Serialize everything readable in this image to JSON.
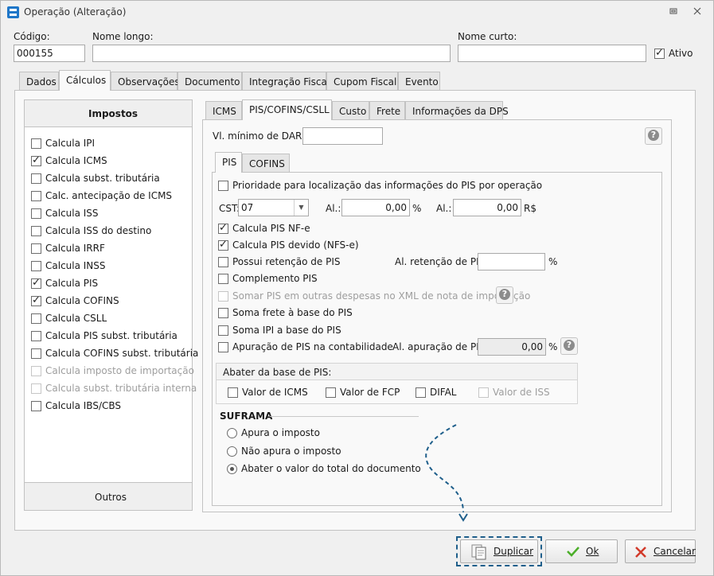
{
  "window": {
    "title": "Operação (Alteração)"
  },
  "header": {
    "codigo_label": "Código:",
    "codigo_value": "000155",
    "nome_longo_label": "Nome longo:",
    "nome_longo_value": "",
    "nome_curto_label": "Nome curto:",
    "nome_curto_value": "",
    "ativo_label": "Ativo",
    "ativo_checked": true
  },
  "main_tabs": [
    "Dados",
    "Cálculos",
    "Observações",
    "Documento",
    "Integração Fiscal",
    "Cupom Fiscal",
    "Evento"
  ],
  "main_tab_active": "Cálculos",
  "impostos": {
    "title": "Impostos",
    "items": [
      {
        "label": "Calcula IPI",
        "checked": false,
        "enabled": true
      },
      {
        "label": "Calcula ICMS",
        "checked": true,
        "enabled": true
      },
      {
        "label": "Calcula subst. tributária",
        "checked": false,
        "enabled": true
      },
      {
        "label": "Calc. antecipação de ICMS",
        "checked": false,
        "enabled": true
      },
      {
        "label": "Calcula ISS",
        "checked": false,
        "enabled": true
      },
      {
        "label": "Calcula ISS do destino",
        "checked": false,
        "enabled": true
      },
      {
        "label": "Calcula IRRF",
        "checked": false,
        "enabled": true
      },
      {
        "label": "Calcula INSS",
        "checked": false,
        "enabled": true
      },
      {
        "label": "Calcula PIS",
        "checked": true,
        "enabled": true
      },
      {
        "label": "Calcula COFINS",
        "checked": true,
        "enabled": true
      },
      {
        "label": "Calcula CSLL",
        "checked": false,
        "enabled": true
      },
      {
        "label": "Calcula PIS subst. tributária",
        "checked": false,
        "enabled": true
      },
      {
        "label": "Calcula COFINS subst. tributária",
        "checked": false,
        "enabled": true
      },
      {
        "label": "Calcula imposto de importação",
        "checked": false,
        "enabled": false
      },
      {
        "label": "Calcula subst. tributária interna",
        "checked": false,
        "enabled": false
      },
      {
        "label": "Calcula IBS/CBS",
        "checked": false,
        "enabled": true
      }
    ],
    "outros_label": "Outros"
  },
  "sub_tabs": [
    "ICMS",
    "PIS/COFINS/CSLL",
    "Custo",
    "Frete",
    "Informações da DPS"
  ],
  "sub_tab_active": "PIS/COFINS/CSLL",
  "darf": {
    "label": "Vl. mínimo de DARF:",
    "value": ""
  },
  "pis_tabs": [
    "PIS",
    "COFINS"
  ],
  "pis_tab_active": "PIS",
  "pis": {
    "prioridade_label": "Prioridade para localização das informações do PIS por operação",
    "cst_label": "CST:",
    "cst_value": "07",
    "al1_label": "Al.:",
    "al1_value": "0,00",
    "al1_unit": "%",
    "al2_label": "Al.:",
    "al2_value": "0,00",
    "al2_unit": "R$",
    "calcula_nfe_label": "Calcula PIS NF-e",
    "calcula_devido_label": "Calcula PIS devido (NFS-e)",
    "retencao_label": "Possui retenção de PIS",
    "al_retencao_label": "Al. retenção de PIS:",
    "al_retencao_value": "",
    "al_retencao_unit": "%",
    "complemento_label": "Complemento PIS",
    "somar_label": "Somar PIS em outras despesas no XML de nota de importação",
    "soma_frete_label": "Soma frete à base do PIS",
    "soma_ipi_label": "Soma IPI a base do PIS",
    "apuracao_label": "Apuração de PIS na contabilidade",
    "al_apuracao_label": "Al. apuração de PIS:",
    "al_apuracao_value": "0,00",
    "al_apuracao_unit": "%",
    "abater_title": "Abater da base de PIS:",
    "abater_icms": "Valor de ICMS",
    "abater_fcp": "Valor de FCP",
    "abater_difal": "DIFAL",
    "abater_iss": "Valor de ISS"
  },
  "suframa": {
    "title": "SUFRAMA",
    "options": [
      "Apura o imposto",
      "Não apura o imposto",
      "Abater o valor do total do documento"
    ],
    "selected": "Abater o valor do total do documento"
  },
  "footer": {
    "duplicar_label": "Duplicar",
    "ok_label": "Ok",
    "cancelar_label": "Cancelar"
  },
  "colors": {
    "accent_arrow": "#1f5f8b",
    "ok_green": "#4caf2a",
    "cancel_red": "#d23a2a"
  }
}
